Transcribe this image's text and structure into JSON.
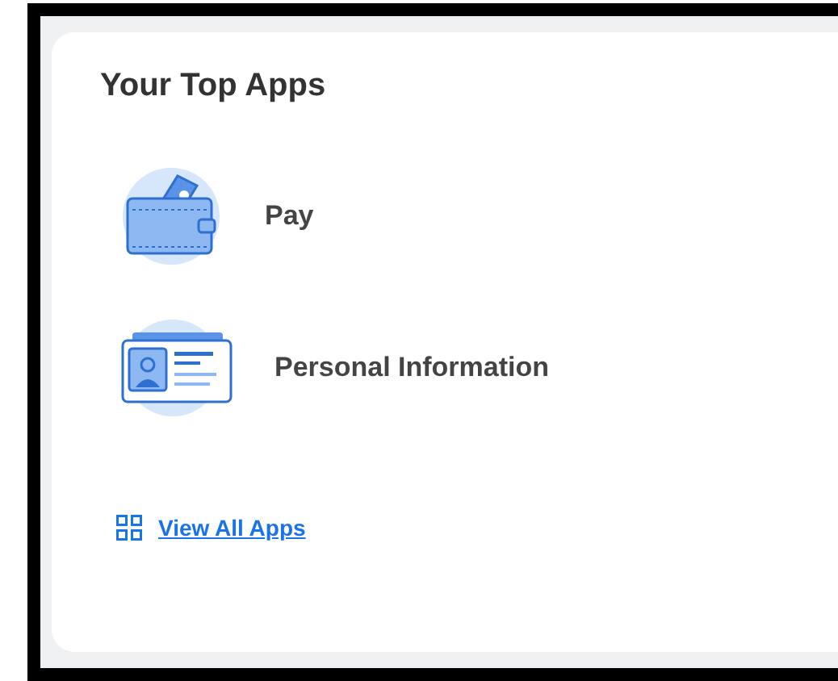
{
  "card": {
    "title": "Your Top Apps"
  },
  "apps": [
    {
      "kind": "wallet",
      "label": "Pay"
    },
    {
      "kind": "id-card",
      "label": "Personal Information"
    }
  ],
  "link": {
    "label": "View All Apps"
  }
}
